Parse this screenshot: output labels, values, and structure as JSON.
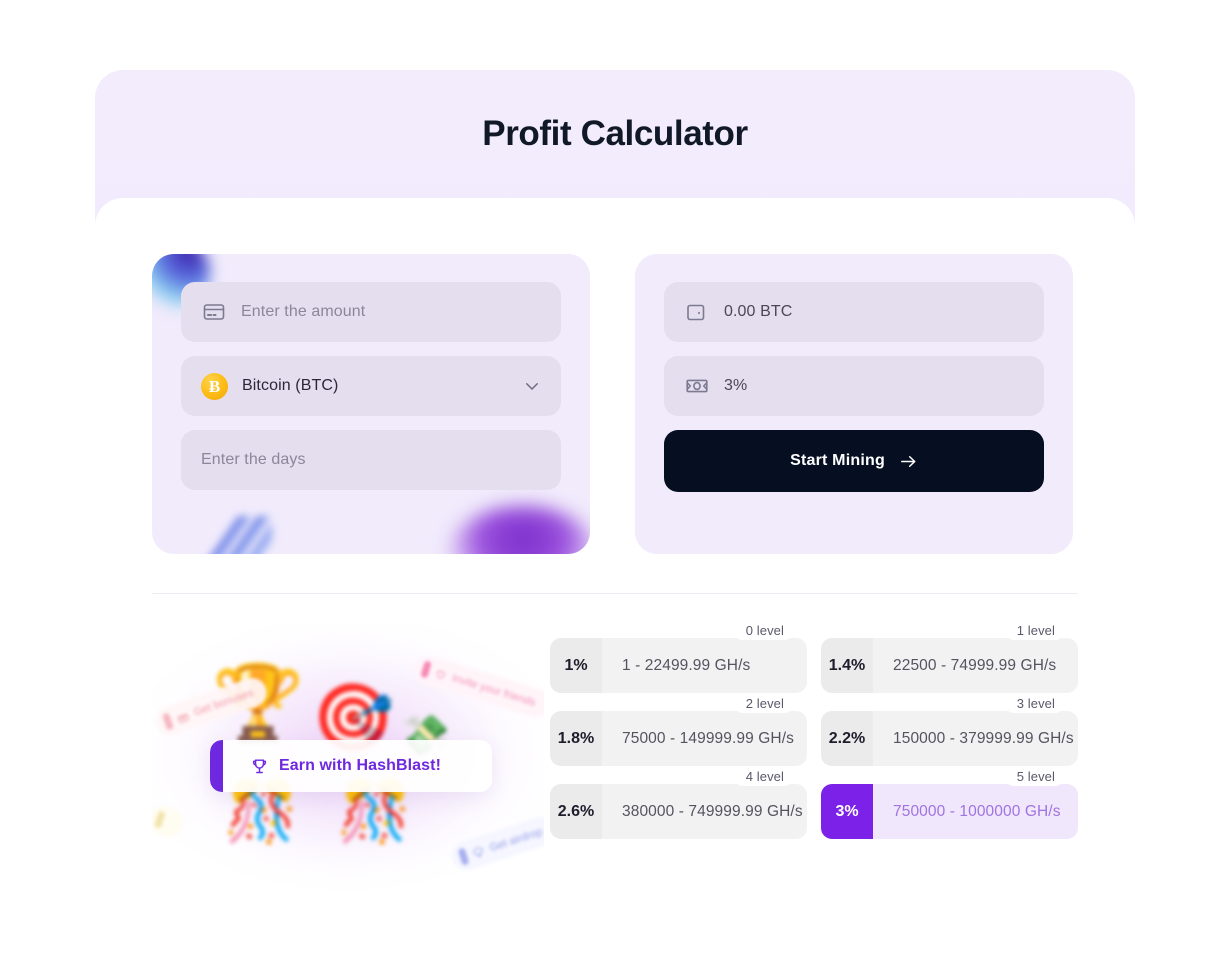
{
  "header": {
    "title": "Profit Calculator"
  },
  "input_panel": {
    "amount_field": {
      "icon": "credit-card-icon",
      "placeholder": "Enter the amount",
      "value": ""
    },
    "currency_select": {
      "icon": "bitcoin-icon",
      "symbol": "Ƀ",
      "selected": "Bitcoin (BTC)",
      "chevron": "chevron-down-icon"
    },
    "days_field": {
      "placeholder": "Enter the days",
      "value": ""
    }
  },
  "result_panel": {
    "payout_field": {
      "icon": "wallet-icon",
      "value": "0.00 BTC"
    },
    "rate_field": {
      "icon": "banknote-icon",
      "value": "3%"
    },
    "cta": {
      "label": "Start Mining",
      "arrow": "arrow-right-icon"
    }
  },
  "promo": {
    "banner_text": "Earn with HashBlast!",
    "banner_icon": "trophy-icon",
    "chips": [
      {
        "text": "Get bonuses",
        "icon": "gift-icon"
      },
      {
        "text": "Invite your friends",
        "icon": "heart-icon"
      },
      {
        "text": "Get airdrop",
        "icon": "parachute-icon"
      },
      {
        "text": "",
        "icon": ""
      }
    ],
    "emojis": {
      "trophy": "🏆",
      "target": "🎯",
      "money": "💸",
      "confetti_left": "🎊",
      "confetti_right": "🎊"
    }
  },
  "tiers": {
    "levels": [
      {
        "label": "0 level",
        "percent": "1%",
        "range": "1 - 22499.99 GH/s",
        "active": false
      },
      {
        "label": "1 level",
        "percent": "1.4%",
        "range": "22500 - 74999.99 GH/s",
        "active": false
      },
      {
        "label": "2 level",
        "percent": "1.8%",
        "range": "75000 - 149999.99 GH/s",
        "active": false
      },
      {
        "label": "3 level",
        "percent": "2.2%",
        "range": "150000 - 379999.99 GH/s",
        "active": false
      },
      {
        "label": "4 level",
        "percent": "2.6%",
        "range": "380000 - 749999.99 GH/s",
        "active": false
      },
      {
        "label": "5 level",
        "percent": "3%",
        "range": "750000 - 1000000 GH/s",
        "active": true
      }
    ]
  },
  "colors": {
    "accent_purple": "#7c22e8",
    "cta_dark": "#060f22",
    "panel_bg": "#f1ebfc",
    "field_bg": "#e4deef",
    "header_bg": "#f2ecfd"
  }
}
